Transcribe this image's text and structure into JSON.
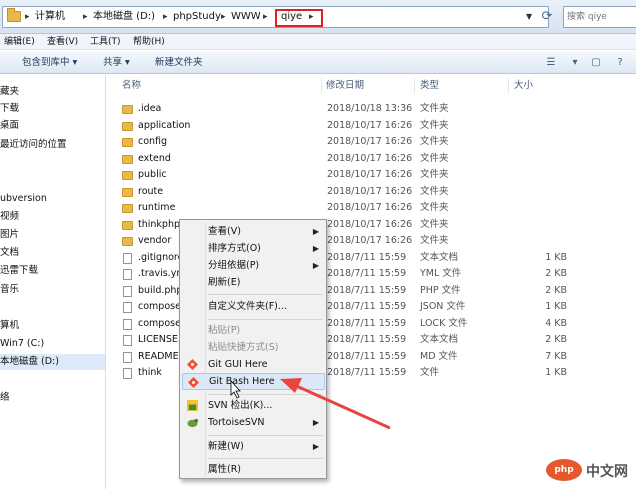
{
  "address": {
    "crumbs": [
      "计算机",
      "本地磁盘 (D:)",
      "phpStudy",
      "WWW",
      "qiye"
    ],
    "search_placeholder": "搜索 qiye"
  },
  "menubar": [
    "编辑(E)",
    "查看(V)",
    "工具(T)",
    "帮助(H)"
  ],
  "toolbar": {
    "include_library": "包含到库中 ▾",
    "share": "共享 ▾",
    "new_folder": "新建文件夹"
  },
  "nav": {
    "items": [
      "藏夹",
      "下载",
      "桌面",
      "最近访问的位置",
      "ubversion",
      "视频",
      "图片",
      "文档",
      "迅雷下载",
      "音乐",
      "算机",
      "Win7 (C:)",
      "本地磁盘 (D:)",
      "络"
    ]
  },
  "columns": {
    "name": "名称",
    "date": "修改日期",
    "type": "类型",
    "size": "大小"
  },
  "files": [
    {
      "name": ".idea",
      "date": "2018/10/18 13:36",
      "type": "文件夹",
      "size": "",
      "kind": "folder"
    },
    {
      "name": "application",
      "date": "2018/10/17 16:26",
      "type": "文件夹",
      "size": "",
      "kind": "folder"
    },
    {
      "name": "config",
      "date": "2018/10/17 16:26",
      "type": "文件夹",
      "size": "",
      "kind": "folder"
    },
    {
      "name": "extend",
      "date": "2018/10/17 16:26",
      "type": "文件夹",
      "size": "",
      "kind": "folder"
    },
    {
      "name": "public",
      "date": "2018/10/17 16:26",
      "type": "文件夹",
      "size": "",
      "kind": "folder"
    },
    {
      "name": "route",
      "date": "2018/10/17 16:26",
      "type": "文件夹",
      "size": "",
      "kind": "folder"
    },
    {
      "name": "runtime",
      "date": "2018/10/17 16:26",
      "type": "文件夹",
      "size": "",
      "kind": "folder"
    },
    {
      "name": "thinkphp",
      "date": "2018/10/17 16:26",
      "type": "文件夹",
      "size": "",
      "kind": "folder"
    },
    {
      "name": "vendor",
      "date": "2018/10/17 16:26",
      "type": "文件夹",
      "size": "",
      "kind": "folder"
    },
    {
      "name": ".gitignore",
      "date": "2018/7/11 15:59",
      "type": "文本文档",
      "size": "1 KB",
      "kind": "file"
    },
    {
      "name": ".travis.yml",
      "date": "2018/7/11 15:59",
      "type": "YML 文件",
      "size": "2 KB",
      "kind": "file"
    },
    {
      "name": "build.php",
      "date": "2018/7/11 15:59",
      "type": "PHP 文件",
      "size": "2 KB",
      "kind": "file"
    },
    {
      "name": "composer",
      "date": "2018/7/11 15:59",
      "type": "JSON 文件",
      "size": "1 KB",
      "kind": "file"
    },
    {
      "name": "composer",
      "date": "2018/7/11 15:59",
      "type": "LOCK 文件",
      "size": "4 KB",
      "kind": "file"
    },
    {
      "name": "LICENSE.txt",
      "date": "2018/7/11 15:59",
      "type": "文本文档",
      "size": "2 KB",
      "kind": "file"
    },
    {
      "name": "README.md",
      "date": "2018/7/11 15:59",
      "type": "MD 文件",
      "size": "7 KB",
      "kind": "file"
    },
    {
      "name": "think",
      "date": "2018/7/11 15:59",
      "type": "文件",
      "size": "1 KB",
      "kind": "file"
    }
  ],
  "context_menu": {
    "view": "查看(V)",
    "sort": "排序方式(O)",
    "group": "分组依据(P)",
    "refresh": "刷新(E)",
    "customize": "自定义文件夹(F)...",
    "paste": "粘贴(P)",
    "paste_shortcut": "粘贴快捷方式(S)",
    "git_gui": "Git GUI Here",
    "git_bash": "Git Bash Here",
    "svn_checkout": "SVN 检出(K)...",
    "tortoise": "TortoiseSVN",
    "new": "新建(W)",
    "properties": "属性(R)"
  },
  "watermark": {
    "logo": "php",
    "text": "中文网"
  },
  "colors": {
    "highlight_box": "#e02020",
    "annotation_arrow": "#e8453c"
  }
}
